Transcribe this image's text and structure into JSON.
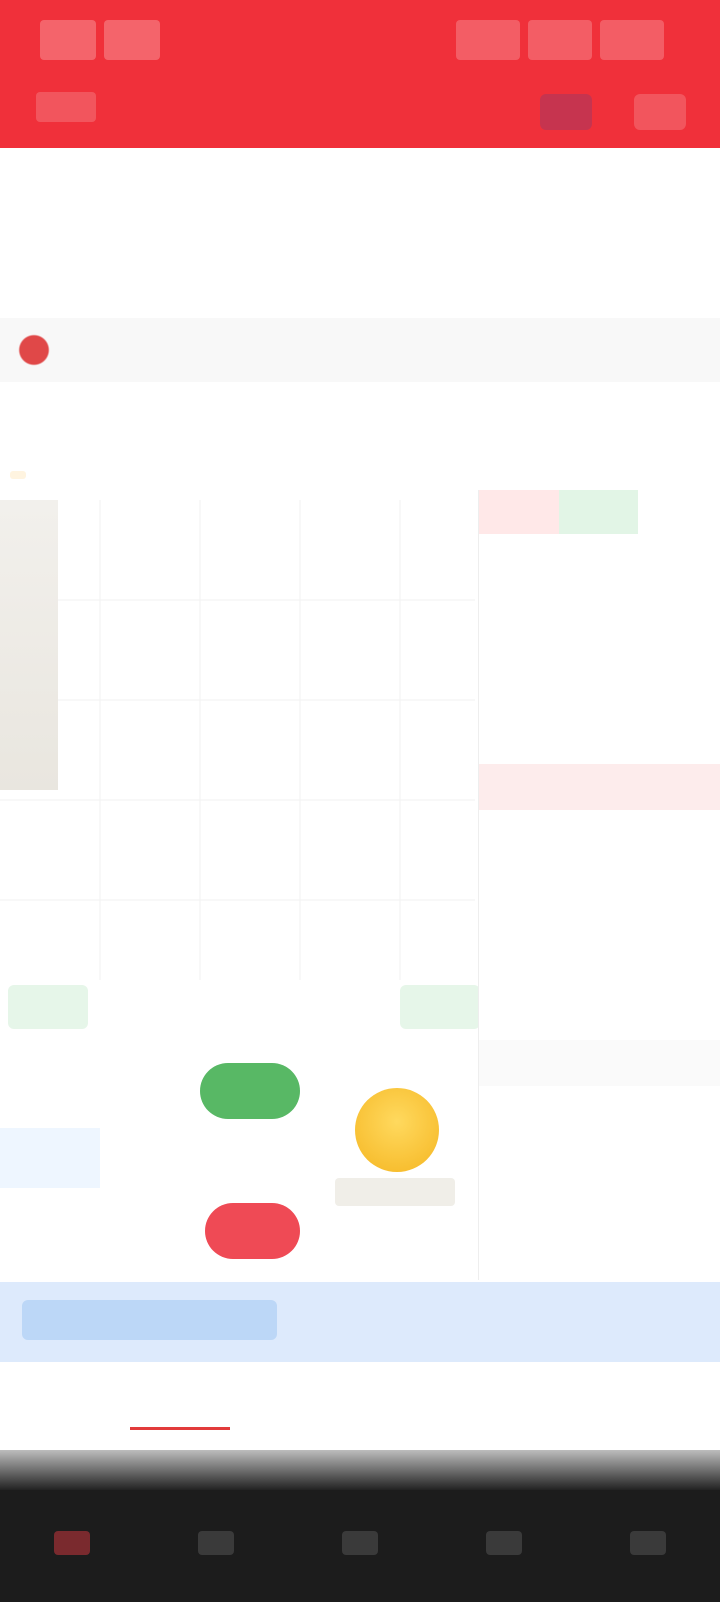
{
  "header": {
    "title": "",
    "subtitle": ""
  },
  "summary": {
    "price": "",
    "change": "",
    "stats": []
  },
  "info": {
    "text": "",
    "right": ""
  },
  "period_tabs": [
    {
      "label": "",
      "active": false
    },
    {
      "label": "",
      "active": false
    },
    {
      "label": "",
      "active": false
    },
    {
      "label": "",
      "active": false
    },
    {
      "label": "",
      "active": false
    },
    {
      "label": "",
      "active": false
    },
    {
      "label": "",
      "active": false
    }
  ],
  "orderbook": {
    "rows": [
      {
        "c1": "",
        "c2": "",
        "c3": ""
      },
      {
        "c1": "",
        "c2": "",
        "c3": ""
      },
      {
        "c1": "",
        "c2": "",
        "c3": ""
      },
      {
        "c1": "",
        "c2": "",
        "c3": ""
      },
      {
        "c1": "",
        "c2": "",
        "c3": ""
      },
      {
        "c1": "",
        "c2": "",
        "c3": ""
      },
      {
        "c1": "",
        "c2": "",
        "c3": ""
      },
      {
        "c1": "",
        "c2": "",
        "c3": ""
      },
      {
        "c1": "",
        "c2": "",
        "c3": ""
      },
      {
        "c1": "",
        "c2": "",
        "c3": ""
      },
      {
        "c1": "",
        "c2": "",
        "c3": ""
      },
      {
        "c1": "",
        "c2": "",
        "c3": ""
      },
      {
        "c1": "",
        "c2": "",
        "c3": ""
      },
      {
        "c1": "",
        "c2": "",
        "c3": ""
      },
      {
        "c1": "",
        "c2": "",
        "c3": ""
      },
      {
        "c1": "",
        "c2": "",
        "c3": ""
      }
    ]
  },
  "banner": {
    "text": "",
    "more": ""
  },
  "bottom_tabs": [
    {
      "label": "",
      "active": false
    },
    {
      "label": "",
      "active": true
    },
    {
      "label": "",
      "active": false
    },
    {
      "label": "",
      "active": false
    },
    {
      "label": "",
      "active": false
    },
    {
      "label": "",
      "active": false
    }
  ],
  "nav": [
    {
      "label": "",
      "icon": "home-icon",
      "active": true
    },
    {
      "label": "",
      "icon": "market-icon",
      "active": false
    },
    {
      "label": "",
      "icon": "trade-icon",
      "active": false
    },
    {
      "label": "",
      "icon": "wealth-icon",
      "active": false
    },
    {
      "label": "",
      "icon": "profile-icon",
      "active": false
    }
  ],
  "colors": {
    "brand_red": "#f0303a",
    "up_red": "#e23b3b",
    "down_green": "#2f9e44",
    "banner_blue": "#ddeafc"
  }
}
